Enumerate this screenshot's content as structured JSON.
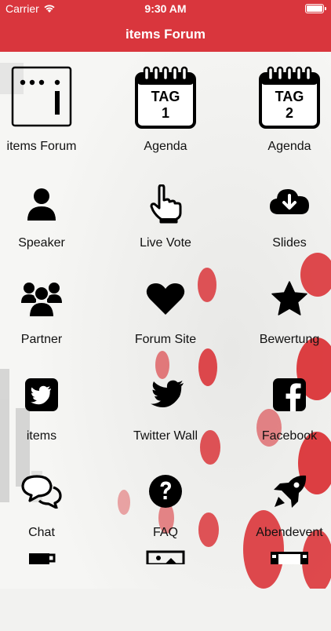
{
  "status_bar": {
    "carrier": "Carrier",
    "time": "9:30 AM"
  },
  "nav": {
    "title": "items Forum"
  },
  "colors": {
    "brand_red": "#d9363d",
    "icon": "#000000",
    "text": "#111111"
  },
  "tiles": [
    {
      "label": "items Forum",
      "icon": "items-logo-icon"
    },
    {
      "label": "Agenda",
      "icon": "calendar-day-1-icon",
      "icon_text": "TAG",
      "icon_num": "1"
    },
    {
      "label": "Agenda",
      "icon": "calendar-day-2-icon",
      "icon_text": "TAG",
      "icon_num": "2"
    },
    {
      "label": "Speaker",
      "icon": "person-icon"
    },
    {
      "label": "Live Vote",
      "icon": "pointing-hand-icon"
    },
    {
      "label": "Slides",
      "icon": "cloud-download-icon"
    },
    {
      "label": "Partner",
      "icon": "group-icon"
    },
    {
      "label": "Forum Site",
      "icon": "heart-icon"
    },
    {
      "label": "Bewertung",
      "icon": "star-icon"
    },
    {
      "label": "items",
      "icon": "twitter-square-icon"
    },
    {
      "label": "Twitter Wall",
      "icon": "twitter-bird-icon"
    },
    {
      "label": "Facebook",
      "icon": "facebook-icon"
    },
    {
      "label": "Chat",
      "icon": "chat-bubbles-icon"
    },
    {
      "label": "FAQ",
      "icon": "question-icon"
    },
    {
      "label": "Abendevent",
      "icon": "rocket-icon"
    }
  ]
}
